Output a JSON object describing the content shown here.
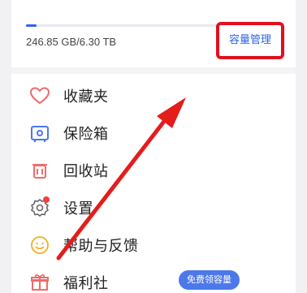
{
  "storage": {
    "used_total": "246.85 GB/6.30 TB",
    "progress_fraction": 0.04,
    "manage_button": "容量管理"
  },
  "menu": {
    "items": [
      {
        "label": "收藏夹",
        "icon": "heart-icon"
      },
      {
        "label": "保险箱",
        "icon": "safe-box-icon"
      },
      {
        "label": "回收站",
        "icon": "trash-icon"
      },
      {
        "label": "设置",
        "icon": "settings-icon"
      },
      {
        "label": "帮助与反馈",
        "icon": "smile-icon"
      },
      {
        "label": "福利社",
        "icon": "gift-icon"
      }
    ],
    "welfare_badge": "免费领容量"
  },
  "colors": {
    "accent": "#2f63e8",
    "highlight_box": "#e10f1f",
    "icon_red": "#ef6b6b",
    "icon_blue": "#4c77e8",
    "icon_yellow": "#f2b530",
    "arrow": "#e51c1c"
  }
}
